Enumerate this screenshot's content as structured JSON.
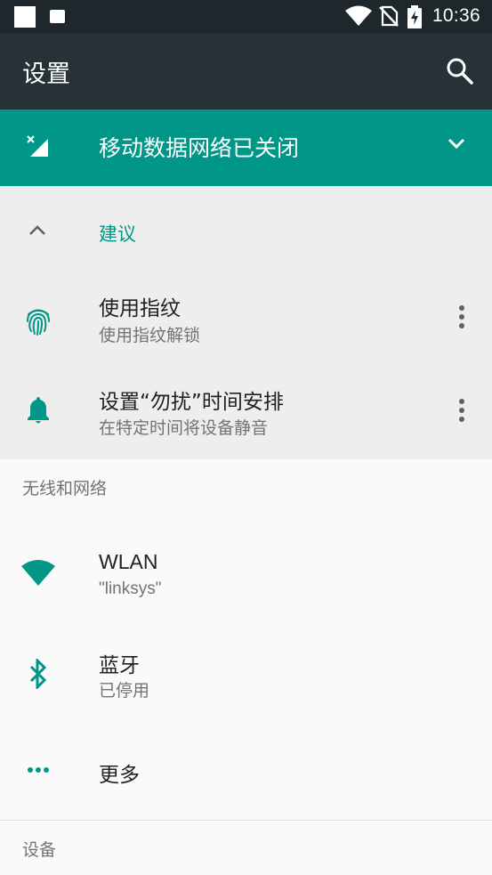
{
  "status_bar": {
    "time": "10:36",
    "icons": [
      "notification-square-icon",
      "notification-small-square-icon",
      "wifi-icon",
      "no-sim-icon",
      "battery-charging-icon"
    ]
  },
  "app_bar": {
    "title": "设置",
    "search_icon": "search-icon"
  },
  "banner": {
    "icon": "mobile-data-off-icon",
    "text": "移动数据网络已关闭",
    "chevron": "chevron-down-icon",
    "background": "#009688"
  },
  "suggestions": {
    "header": "建议",
    "items": [
      {
        "title": "使用指纹",
        "subtitle": "使用指纹解锁",
        "icon": "fingerprint-icon"
      },
      {
        "title": "设置“勿扰”时间安排",
        "subtitle": "在特定时间将设备静音",
        "icon": "bell-icon"
      }
    ]
  },
  "sections": [
    {
      "header": "无线和网络",
      "items": [
        {
          "title": "WLAN",
          "subtitle": "\"linksys\"",
          "icon": "wifi-icon"
        },
        {
          "title": "蓝牙",
          "subtitle": "已停用",
          "icon": "bluetooth-icon"
        },
        {
          "title": "更多",
          "subtitle": "",
          "icon": "more-horiz-icon"
        }
      ]
    },
    {
      "header": "设备",
      "items": []
    }
  ],
  "colors": {
    "accent": "#009688",
    "status_bar": "#1e272c",
    "app_bar": "#263238",
    "suggestion_bg": "#eeeeee"
  }
}
